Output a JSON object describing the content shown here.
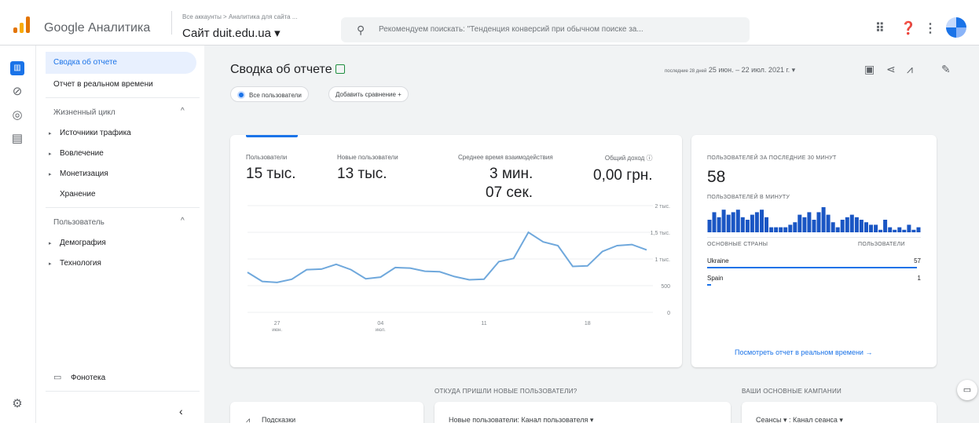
{
  "header": {
    "app_name": "Google Аналитика",
    "breadcrumb": "Все аккаунты > Аналитика для сайта ...",
    "property": "Сайт duit.edu.ua ▾",
    "search_placeholder": "Рекомендуем поискать: \"Тенденция конверсий при обычном поиске за...",
    "icons": [
      "apps-icon",
      "help-icon",
      "more-icon",
      "avatar"
    ]
  },
  "rail": {
    "icons": [
      "reports-icon",
      "explore-icon",
      "advertising-icon",
      "configure-icon",
      "settings-icon"
    ]
  },
  "sidebar": {
    "active": "Сводка об отчете",
    "realtime": "Отчет в реальном времени",
    "lifecycle": {
      "title": "Жизненный цикл",
      "items": [
        "Источники трафика",
        "Вовлечение",
        "Монетизация"
      ],
      "extra": "Хранение"
    },
    "user": {
      "title": "Пользователь",
      "items": [
        "Демография",
        "Технология"
      ]
    },
    "library": "Фонотека",
    "collapse": "‹"
  },
  "main": {
    "title": "Сводка об отчете",
    "date_prefix": "последние 28 дней",
    "date_range": "25 июн. – 22 июл. 2021 г. ▾",
    "chip_all_users": "Все пользователи",
    "chip_add_compare": "Добавить сравнение +",
    "metrics": [
      {
        "label": "Пользователи",
        "value": "15 тыс."
      },
      {
        "label": "Новые пользователи",
        "value": "13 тыс."
      },
      {
        "label": "Среднее время взаимодействия",
        "value_line1": "3 мин.",
        "value_line2": "07 сек."
      },
      {
        "label": "Общий доход ⓘ",
        "value": "0,00 грн."
      }
    ]
  },
  "chart_data": {
    "type": "line",
    "y_ticks": [
      "2 тыс.",
      "1,5 тыс.",
      "1 тыс.",
      "500",
      "0"
    ],
    "ylim": [
      0,
      2000
    ],
    "x_ticks": [
      {
        "label": "27",
        "sub": "июн."
      },
      {
        "label": "04",
        "sub": "июл."
      },
      {
        "label": "11",
        "sub": ""
      },
      {
        "label": "18",
        "sub": ""
      }
    ],
    "series": [
      {
        "values": [
          750,
          580,
          560,
          620,
          800,
          810,
          900,
          800,
          630,
          660,
          840,
          830,
          770,
          760,
          670,
          610,
          620,
          950,
          1010,
          1500,
          1320,
          1250,
          860,
          870,
          1140,
          1250,
          1270,
          1170
        ]
      }
    ],
    "grid": true
  },
  "realtime": {
    "title": "ПОЛЬЗОВАТЕЛЕЙ ЗА ПОСЛЕДНИЕ 30 МИНУТ",
    "value": "58",
    "per_minute": "ПОЛЬЗОВАТЕЛЕЙ В МИНУТУ",
    "bars": [
      5,
      8,
      6,
      9,
      7,
      8,
      9,
      6,
      5,
      7,
      8,
      9,
      6,
      2,
      2,
      2,
      2,
      3,
      4,
      7,
      6,
      8,
      5,
      8,
      10,
      7,
      4,
      2,
      5,
      6,
      7,
      6,
      5,
      4,
      3,
      3,
      1,
      5,
      2,
      1,
      2,
      1,
      3,
      1,
      2
    ],
    "col_country": "ОСНОВНЫЕ СТРАНЫ",
    "col_users": "ПОЛЬЗОВАТЕЛИ",
    "rows": [
      {
        "country": "Ukraine",
        "users": "57",
        "share": 0.98
      },
      {
        "country": "Spain",
        "users": "1",
        "share": 0.02
      }
    ],
    "link": "Посмотреть отчет в реальном времени →"
  },
  "lower": {
    "insights": "Подсказки",
    "new_users_title": "ОТКУДА ПРИШЛИ НОВЫЕ ПОЛЬЗОВАТЕЛИ?",
    "new_users_dim": "Новые пользователи: Канал пользователя ▾",
    "campaigns_title": "ВАШИ ОСНОВНЫЕ КАМПАНИИ",
    "campaigns_dim": "Сеансы ▾ : Канал сеанса ▾"
  },
  "colors": {
    "accent": "#1a73e8",
    "line": "#6fa8dc",
    "bars": "#1a56c4"
  }
}
